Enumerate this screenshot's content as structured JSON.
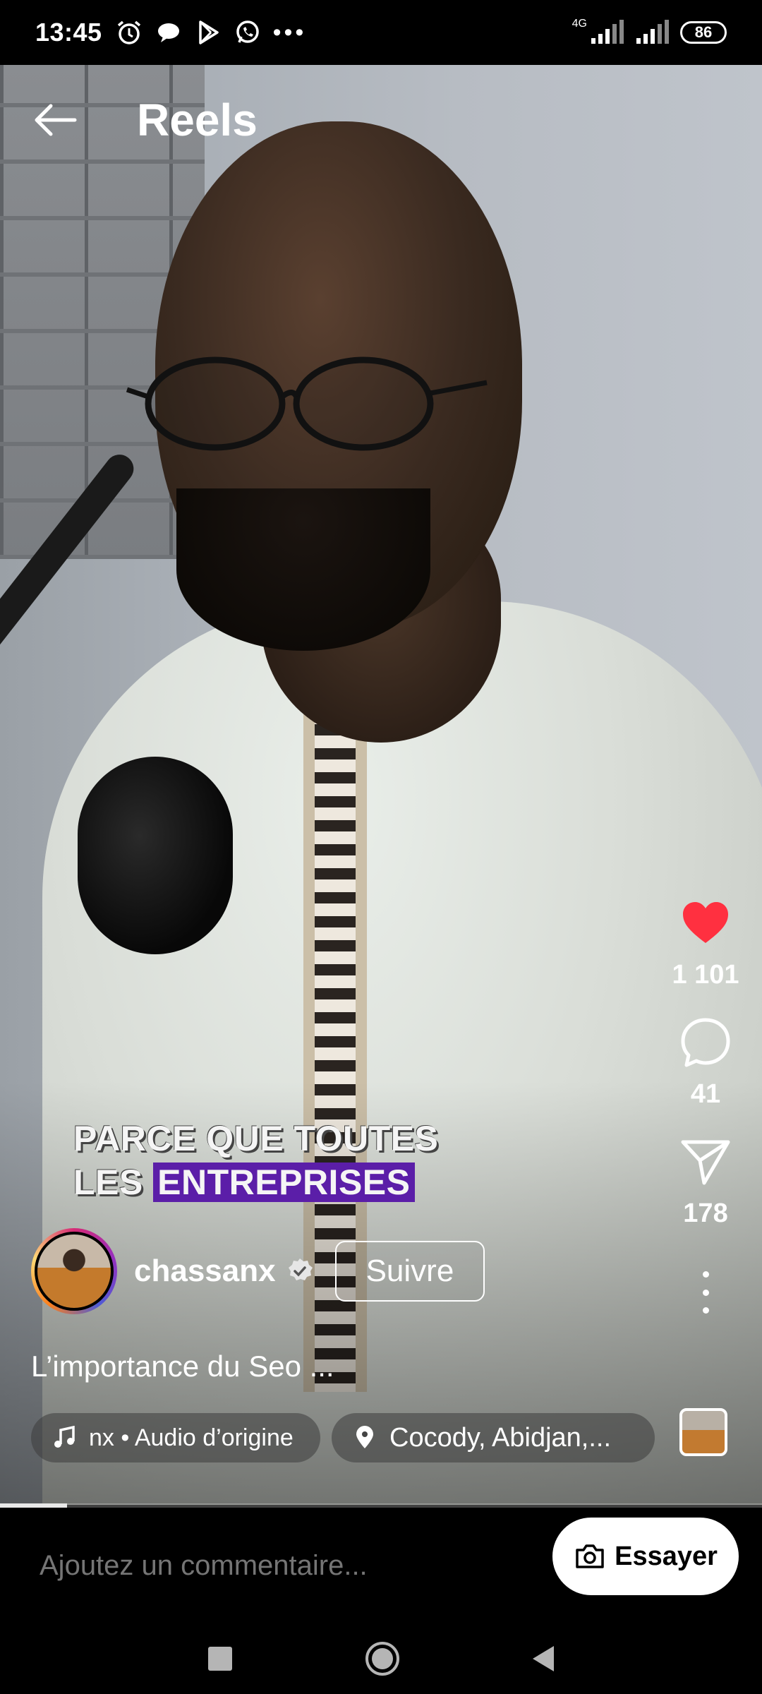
{
  "status_bar": {
    "time": "13:45",
    "network": "4G",
    "battery": "86",
    "left_icons": [
      "alarm-icon",
      "chat-bubble-icon",
      "play-store-icon",
      "whatsapp-icon"
    ],
    "overflow": "•••"
  },
  "header": {
    "title": "Reels",
    "back_icon": "arrow-left-icon"
  },
  "video": {
    "caption_line1": "PARCE QUE TOUTES",
    "caption_line2_prefix": "LES ",
    "caption_line2_highlight": "ENTREPRISES",
    "highlight_color": "#5b1ea8",
    "progress_fraction": 0.088
  },
  "actions": {
    "like_count": "1 101",
    "comment_count": "41",
    "share_count": "178",
    "like_color": "#ff3040"
  },
  "post": {
    "username": "chassanx",
    "verified": true,
    "follow_label": "Suivre",
    "description": "L’importance du Seo ...",
    "audio_label": "nx • Audio d’origine",
    "location_label": "Cocody, Abidjan,..."
  },
  "comment_bar": {
    "placeholder": "Ajoutez un commentaire...",
    "try_label": "Essayer"
  }
}
